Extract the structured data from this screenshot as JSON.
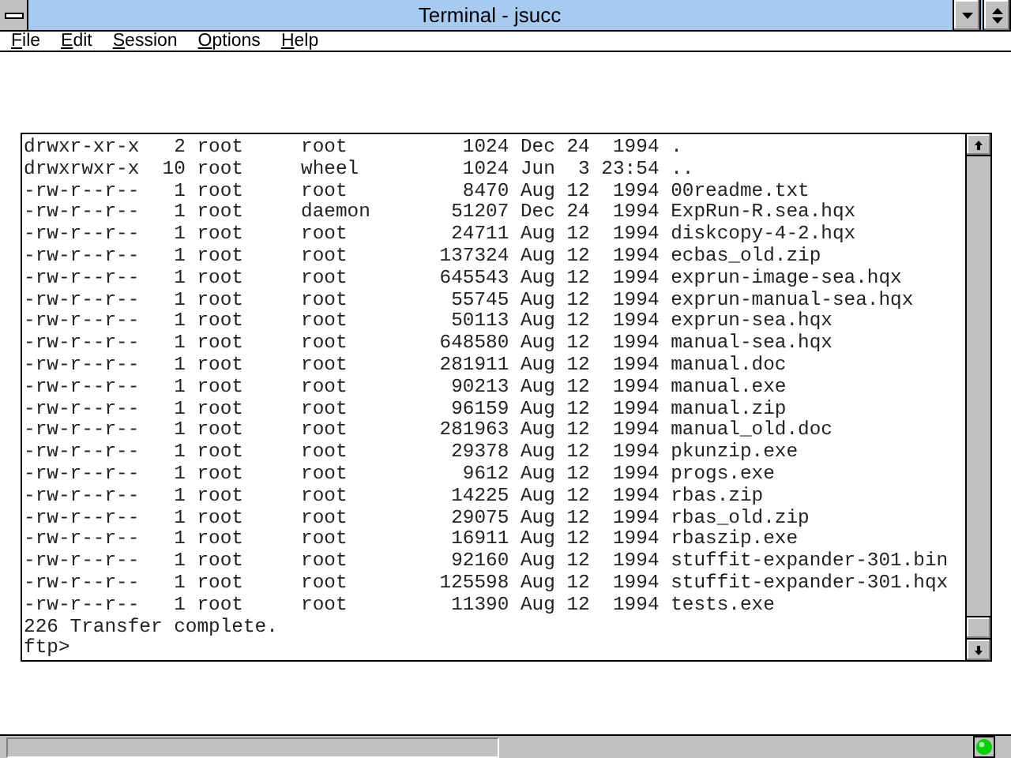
{
  "window": {
    "title": "Terminal - jsucc"
  },
  "menu": [
    {
      "label": "File"
    },
    {
      "label": "Edit"
    },
    {
      "label": "Session"
    },
    {
      "label": "Options"
    },
    {
      "label": "Help"
    }
  ],
  "terminal": {
    "lines": [
      "drwxr-xr-x   2 root     root          1024 Dec 24  1994 .",
      "drwxrwxr-x  10 root     wheel         1024 Jun  3 23:54 ..",
      "-rw-r--r--   1 root     root          8470 Aug 12  1994 00readme.txt",
      "-rw-r--r--   1 root     daemon       51207 Dec 24  1994 ExpRun-R.sea.hqx",
      "-rw-r--r--   1 root     root         24711 Aug 12  1994 diskcopy-4-2.hqx",
      "-rw-r--r--   1 root     root        137324 Aug 12  1994 ecbas_old.zip",
      "-rw-r--r--   1 root     root        645543 Aug 12  1994 exprun-image-sea.hqx",
      "-rw-r--r--   1 root     root         55745 Aug 12  1994 exprun-manual-sea.hqx",
      "-rw-r--r--   1 root     root         50113 Aug 12  1994 exprun-sea.hqx",
      "-rw-r--r--   1 root     root        648580 Aug 12  1994 manual-sea.hqx",
      "-rw-r--r--   1 root     root        281911 Aug 12  1994 manual.doc",
      "-rw-r--r--   1 root     root         90213 Aug 12  1994 manual.exe",
      "-rw-r--r--   1 root     root         96159 Aug 12  1994 manual.zip",
      "-rw-r--r--   1 root     root        281963 Aug 12  1994 manual_old.doc",
      "-rw-r--r--   1 root     root         29378 Aug 12  1994 pkunzip.exe",
      "-rw-r--r--   1 root     root          9612 Aug 12  1994 progs.exe",
      "-rw-r--r--   1 root     root         14225 Aug 12  1994 rbas.zip",
      "-rw-r--r--   1 root     root         29075 Aug 12  1994 rbas_old.zip",
      "-rw-r--r--   1 root     root         16911 Aug 12  1994 rbaszip.exe",
      "-rw-r--r--   1 root     root         92160 Aug 12  1994 stuffit-expander-301.bin",
      "-rw-r--r--   1 root     root        125598 Aug 12  1994 stuffit-expander-301.hqx",
      "-rw-r--r--   1 root     root         11390 Aug 12  1994 tests.exe",
      "226 Transfer complete.",
      "ftp>"
    ]
  }
}
